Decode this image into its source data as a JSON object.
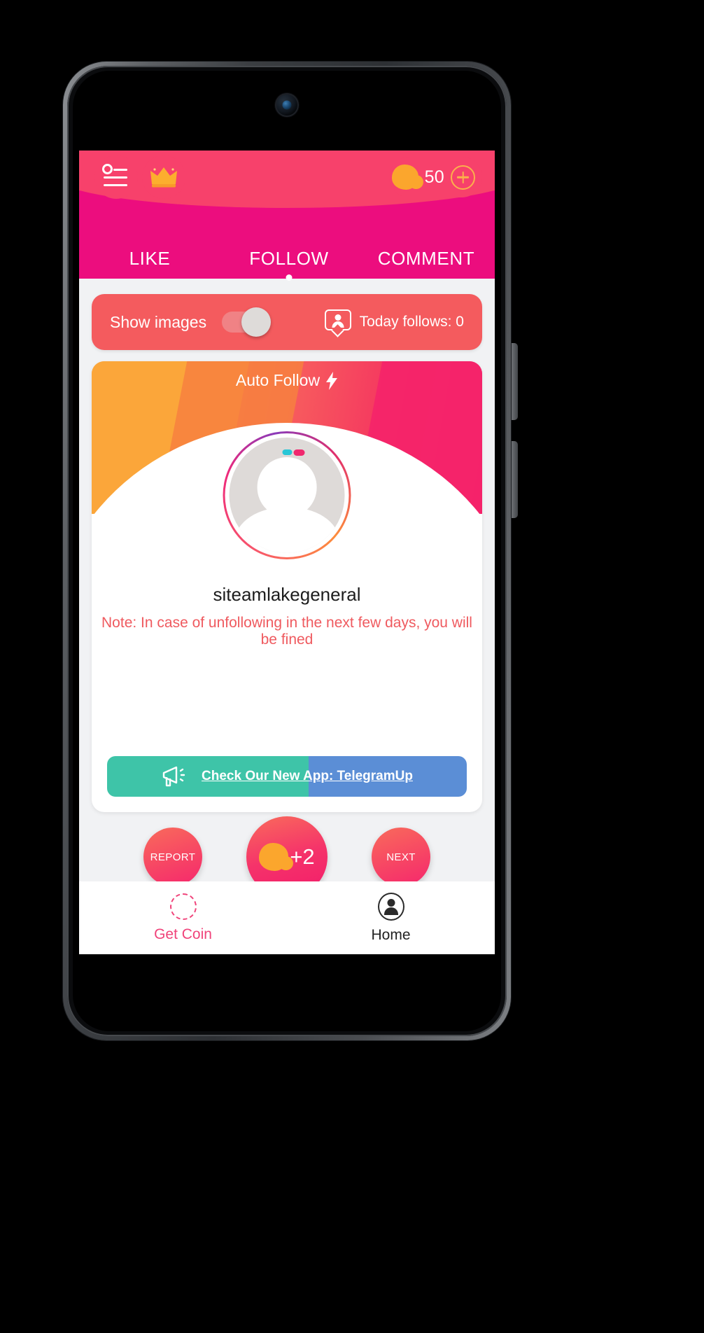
{
  "header": {
    "menu_icon": "hamburger-menu-icon",
    "crown_icon": "crown-icon",
    "coin_icon": "coin-icon",
    "coin_count": "50",
    "add_coin_icon": "plus-circle-icon",
    "bar_color": "#ec0d7e",
    "accent_color": "#f7416b"
  },
  "tabs": [
    {
      "label": "LIKE",
      "active": false
    },
    {
      "label": "FOLLOW",
      "active": true
    },
    {
      "label": "COMMENT",
      "active": false
    }
  ],
  "toggle_row": {
    "label": "Show images",
    "switch_state": "on",
    "stats_icon": "user-bubble-icon",
    "stats_label": "Today follows: 0",
    "background": "#f45b5e"
  },
  "card": {
    "hero_title": "Auto Follow",
    "hero_icon": "lightning-bolt-icon",
    "avatar_icon": "profile-placeholder-avatar",
    "username": "siteamlakegeneral",
    "note": "Note: In case of unfollowing in the next few days, you will be fined",
    "note_color": "#ef5a5f"
  },
  "promo": {
    "icon": "megaphone-icon",
    "text": "Check Our New App: TelegramUp",
    "left_color": "#3ec4a8",
    "right_color": "#5b8ed6"
  },
  "actions": {
    "report_label": "REPORT",
    "next_label": "NEXT",
    "main_coin_icon": "coin-icon",
    "main_amount": "+2"
  },
  "bottom_nav": [
    {
      "label": "Get Coin",
      "icon": "coin-circle-icon",
      "active": true
    },
    {
      "label": "Home",
      "icon": "home-person-icon",
      "active": false
    }
  ]
}
